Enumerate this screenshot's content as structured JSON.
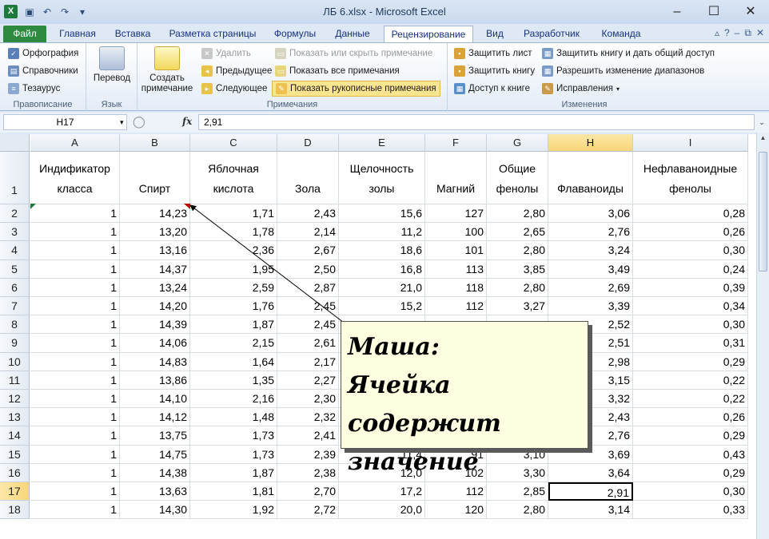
{
  "window": {
    "title": "ЛБ 6.xlsx  -  Microsoft Excel",
    "app_badge": "X"
  },
  "tabs": [
    "Файл",
    "Главная",
    "Вставка",
    "Разметка страницы",
    "Формулы",
    "Данные",
    "Рецензирование",
    "Вид",
    "Разработчик",
    "Команда"
  ],
  "ribbon": {
    "spelling": {
      "label": "Правописание",
      "items": [
        "Орфография",
        "Справочники",
        "Тезаурус"
      ]
    },
    "language": {
      "label": "Язык",
      "translate": "Перевод"
    },
    "comments": {
      "label": "Примечания",
      "create": "Создать примечание",
      "delete": "Удалить",
      "prev": "Предыдущее",
      "next": "Следующее",
      "show_hide": "Показать или скрыть примечание",
      "show_all": "Показать все примечания",
      "show_ink": "Показать рукописные примечания"
    },
    "changes": {
      "label": "Изменения",
      "protect_sheet": "Защитить лист",
      "protect_book": "Защитить книгу",
      "share_book": "Доступ к книге",
      "protect_share": "Защитить книгу и дать общий доступ",
      "allow_ranges": "Разрешить изменение диапазонов",
      "track": "Исправления"
    }
  },
  "formula_bar": {
    "name_box": "H17",
    "fx": "fx",
    "value": "2,91"
  },
  "columns": [
    "A",
    "B",
    "C",
    "D",
    "E",
    "F",
    "G",
    "H",
    "I"
  ],
  "header_row": [
    "Индификатор класса",
    "Спирт",
    "Яблочная кислота",
    "Зола",
    "Щелочность золы",
    "Магний",
    "Общие фенолы",
    "Флаванои­ды",
    "Нефлаваноидн­ые фенолы"
  ],
  "rows": [
    {
      "n": "2",
      "v": [
        "1",
        "14,23",
        "1,71",
        "2,43",
        "15,6",
        "127",
        "2,80",
        "3,06",
        "0,28"
      ]
    },
    {
      "n": "3",
      "v": [
        "1",
        "13,20",
        "1,78",
        "2,14",
        "11,2",
        "100",
        "2,65",
        "2,76",
        "0,26"
      ]
    },
    {
      "n": "4",
      "v": [
        "1",
        "13,16",
        "2,36",
        "2,67",
        "18,6",
        "101",
        "2,80",
        "3,24",
        "0,30"
      ]
    },
    {
      "n": "5",
      "v": [
        "1",
        "14,37",
        "1,95",
        "2,50",
        "16,8",
        "113",
        "3,85",
        "3,49",
        "0,24"
      ]
    },
    {
      "n": "6",
      "v": [
        "1",
        "13,24",
        "2,59",
        "2,87",
        "21,0",
        "118",
        "2,80",
        "2,69",
        "0,39"
      ]
    },
    {
      "n": "7",
      "v": [
        "1",
        "14,20",
        "1,76",
        "2,45",
        "15,2",
        "112",
        "3,27",
        "3,39",
        "0,34"
      ]
    },
    {
      "n": "8",
      "v": [
        "1",
        "14,39",
        "1,87",
        "2,45",
        "",
        "",
        "",
        "2,52",
        "0,30"
      ]
    },
    {
      "n": "9",
      "v": [
        "1",
        "14,06",
        "2,15",
        "2,61",
        "",
        "",
        "",
        "2,51",
        "0,31"
      ]
    },
    {
      "n": "10",
      "v": [
        "1",
        "14,83",
        "1,64",
        "2,17",
        "",
        "",
        "",
        "2,98",
        "0,29"
      ]
    },
    {
      "n": "11",
      "v": [
        "1",
        "13,86",
        "1,35",
        "2,27",
        "",
        "",
        "",
        "3,15",
        "0,22"
      ]
    },
    {
      "n": "12",
      "v": [
        "1",
        "14,10",
        "2,16",
        "2,30",
        "",
        "",
        "",
        "3,32",
        "0,22"
      ]
    },
    {
      "n": "13",
      "v": [
        "1",
        "14,12",
        "1,48",
        "2,32",
        "",
        "",
        "",
        "2,43",
        "0,26"
      ]
    },
    {
      "n": "14",
      "v": [
        "1",
        "13,75",
        "1,73",
        "2,41",
        "",
        "",
        "",
        "2,76",
        "0,29"
      ]
    },
    {
      "n": "15",
      "v": [
        "1",
        "14,75",
        "1,73",
        "2,39",
        "11,4",
        "91",
        "3,10",
        "3,69",
        "0,43"
      ]
    },
    {
      "n": "16",
      "v": [
        "1",
        "14,38",
        "1,87",
        "2,38",
        "12,0",
        "102",
        "3,30",
        "3,64",
        "0,29"
      ]
    },
    {
      "n": "17",
      "v": [
        "1",
        "13,63",
        "1,81",
        "2,70",
        "17,2",
        "112",
        "2,85",
        "2,91",
        "0,30"
      ]
    },
    {
      "n": "18",
      "v": [
        "1",
        "14,30",
        "1,92",
        "2,72",
        "20,0",
        "120",
        "2,80",
        "3,14",
        "0,33"
      ]
    }
  ],
  "comment": {
    "author": "Маша:",
    "text": "Ячейка содержит значение"
  }
}
